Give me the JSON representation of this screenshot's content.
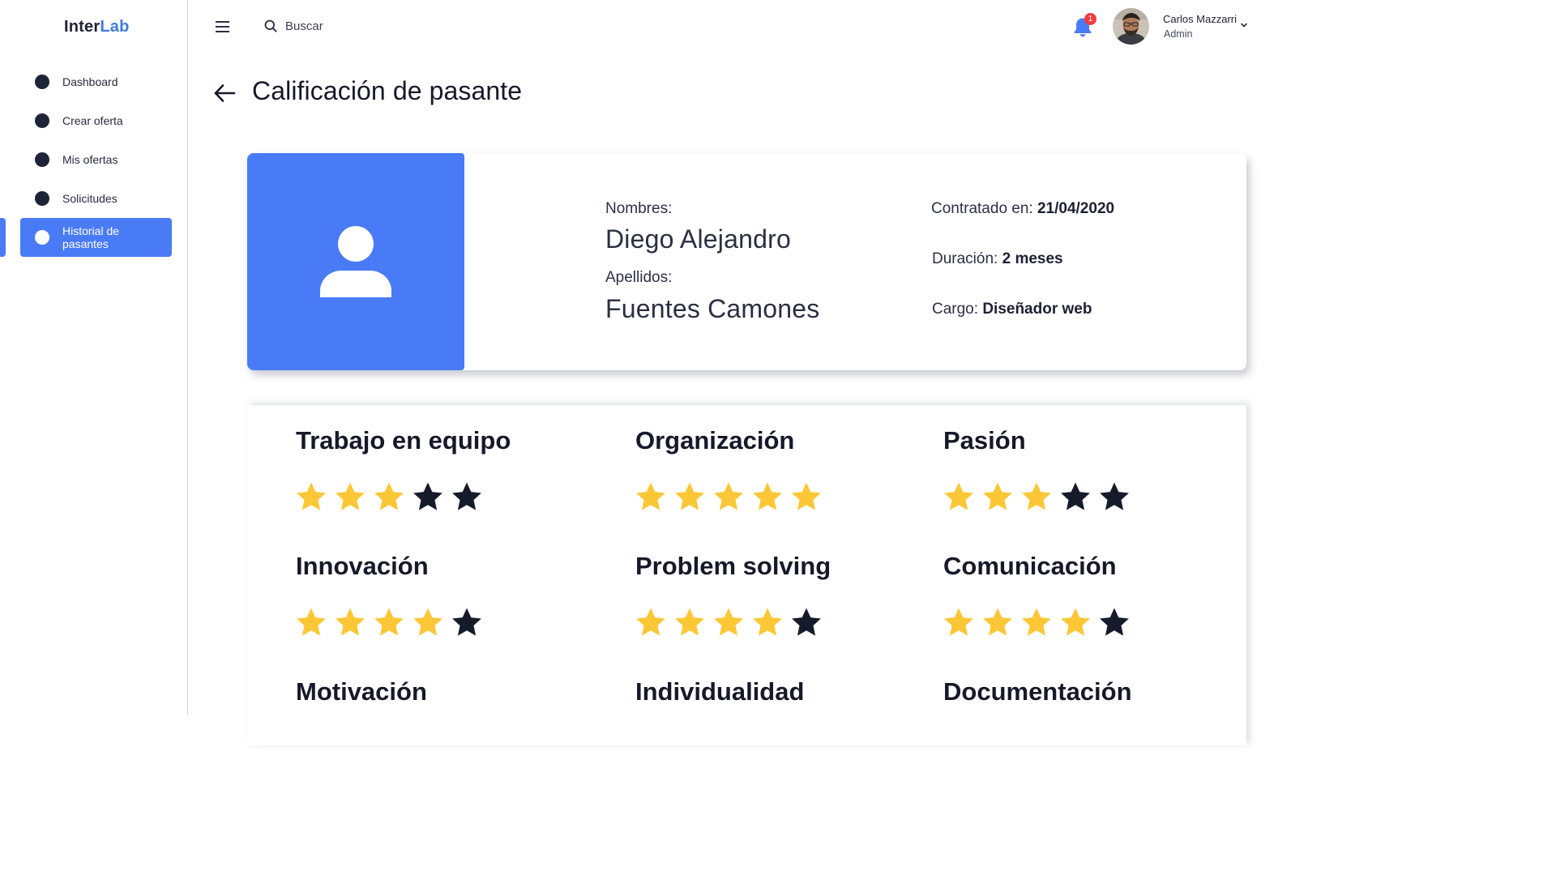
{
  "sidebar": {
    "logo_part1": "Inter",
    "logo_part2": "Lab",
    "items": [
      {
        "label": "Dashboard"
      },
      {
        "label": "Crear oferta"
      },
      {
        "label": "Mis ofertas"
      },
      {
        "label": "Solicitudes"
      },
      {
        "label": "Historial de pasantes",
        "active": true
      }
    ]
  },
  "header": {
    "search_placeholder": "Buscar",
    "notification_count": "1",
    "user_name": "Carlos Mazzarri",
    "user_role": "Admin"
  },
  "page": {
    "title": "Calificación de pasante"
  },
  "profile": {
    "first_name_label": "Nombres:",
    "first_name": "Diego Alejandro",
    "last_name_label": "Apellidos:",
    "last_name": "Fuentes Camones",
    "hired_label": "Contratado en:",
    "hired_value": "21/04/2020",
    "duration_label": "Duración:",
    "duration_value": "2 meses",
    "position_label": "Cargo:",
    "position_value": "Diseñador web"
  },
  "ratings": [
    {
      "label": "Trabajo en equipo",
      "score": 3,
      "max": 5
    },
    {
      "label": "Organización",
      "score": 5,
      "max": 5
    },
    {
      "label": "Pasión",
      "score": 3,
      "max": 5
    },
    {
      "label": "Innovación",
      "score": 4,
      "max": 5
    },
    {
      "label": "Problem solving",
      "score": 4,
      "max": 5
    },
    {
      "label": "Comunicación",
      "score": 4,
      "max": 5
    },
    {
      "label": "Motivación",
      "score": null,
      "max": 5
    },
    {
      "label": "Individualidad",
      "score": null,
      "max": 5
    },
    {
      "label": "Documentación",
      "score": null,
      "max": 5
    }
  ],
  "colors": {
    "accent": "#4a7bf7",
    "star_filled": "#fcc736",
    "star_empty": "#161b2b",
    "sidebar_dot": "#1e2438",
    "badge": "#f03c3c"
  }
}
